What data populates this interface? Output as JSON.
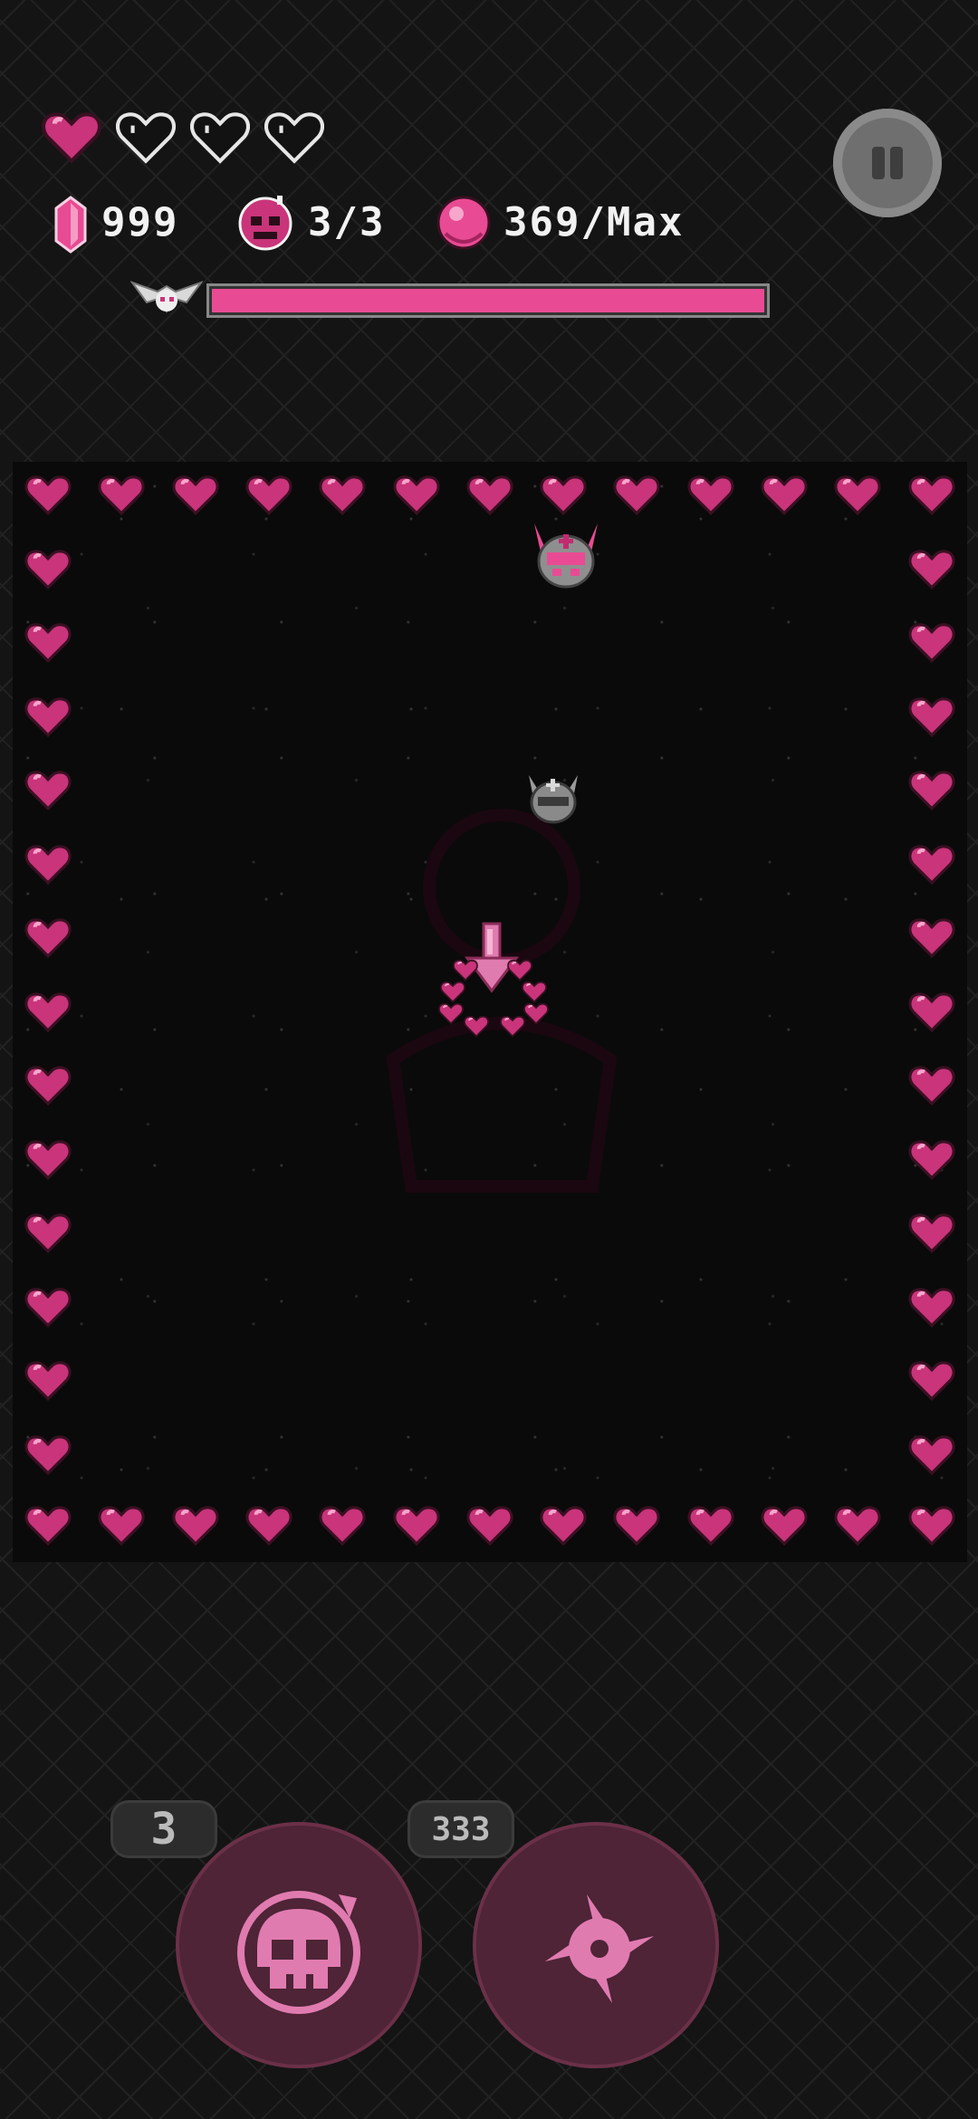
{
  "hud": {
    "lives": {
      "filled": 1,
      "total": 4
    },
    "gems": "999",
    "bombs": "3/3",
    "orbs": "369/Max",
    "boss_health_fraction": 1.0
  },
  "controls": {
    "bomb_count": "3",
    "shuriken_count": "333"
  },
  "colors": {
    "accent": "#e84b93",
    "heart": "#d63a84",
    "background": "#141414",
    "arena": "#0a0a0a",
    "button": "#4e2436",
    "button_icon": "#e07bb0"
  },
  "icons": {
    "gem": "gem-icon",
    "bomb": "skull-bomb-icon",
    "orb": "orb-icon",
    "boss": "winged-skull-icon",
    "pause": "pause-icon",
    "shuriken": "shuriken-icon"
  }
}
